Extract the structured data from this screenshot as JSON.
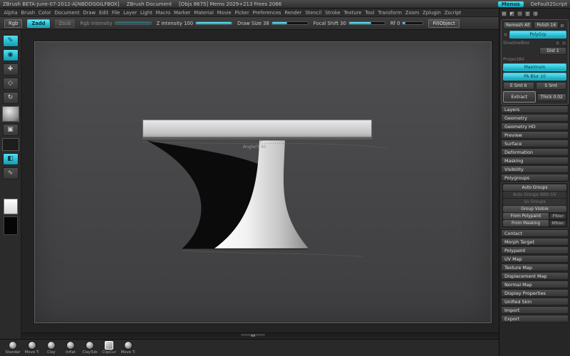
{
  "colors": {
    "accent": "#2fc9de",
    "panel_bg": "#262626",
    "canvas_bg": "#3f3f41"
  },
  "title_bar": {
    "app_title": "ZBrush BETA-June-07-2012-A[NBDDGGILFBOX]",
    "doc_title": "ZBrush Document",
    "stats": "[Objs 8675] Mems 2029+213 Frees 2066",
    "menus_label": "Menus",
    "script_label": "DeFault2Script"
  },
  "menu_bar": {
    "items": [
      "Alpha",
      "Brush",
      "Color",
      "Document",
      "Draw",
      "Edit",
      "File",
      "Layer",
      "Light",
      "Macro",
      "Marker",
      "Material",
      "Movie",
      "Picker",
      "Preferences",
      "Render",
      "Stencil",
      "Stroke",
      "Texture",
      "Tool",
      "Transform",
      "Zoom",
      "Zplugin",
      "Zscript"
    ]
  },
  "top_shelf": {
    "rgb": "Rgb",
    "zadd": "Zadd",
    "zsub": "Zsub",
    "rgb_intensity": "Rgb Intensity",
    "z_intensity": "Z Intensity 100",
    "draw_size": "Draw Size 38",
    "focal_shift": "Focal Shift 30",
    "rf": "Rf 0",
    "fill_object": "FillObject"
  },
  "left_shelf": {
    "icons": {
      "edit": "✎",
      "draw": "◉",
      "move": "✚",
      "scale": "◇",
      "rotate": "↻",
      "defo": "▣",
      "sample": "◧",
      "stroke": "∿"
    }
  },
  "canvas": {
    "annotation": "Angle(Y 90",
    "axis_mark": "+"
  },
  "right_panel": {
    "header_icons": [
      "▤",
      "◩",
      "◎",
      "▥",
      "◍"
    ],
    "subtool_box": {
      "remesh_all": "Remesh All",
      "polish": "Polish 16",
      "polish_curve_icon": "⊙",
      "polygrp": "PolyGrp",
      "shadowbox": "ShadowBox",
      "dist": "Dist 1",
      "projectall": "ProjectAll",
      "maximum": "Maximum",
      "pa_blur": "PA Blur 10",
      "e_smt": "E Smt 6",
      "s_smt": "S Smt",
      "extract": "Extract",
      "thick": "Thick 0.02"
    },
    "sections_top": [
      "Layers",
      "Geometry",
      "Geometry HD",
      "Preview",
      "Surface",
      "Deformation",
      "Masking",
      "Visibility"
    ],
    "polygroups": {
      "header": "Polygroups",
      "auto_groups": "Auto Groups",
      "auto_groups_uv": "Auto Groups With UV",
      "uv_groups": "Uv Groups",
      "group_visible": "Group Visible",
      "from_polypaint": "From Polypaint",
      "ptol": "PTolor",
      "from_masking": "From Masking",
      "mtol": "MTolor"
    },
    "sections_bottom": [
      "Contact",
      "Morph Target",
      "Polypaint",
      "UV Map",
      "Texture Map",
      "Displacement Map",
      "Normal Map",
      "Display Properties",
      "Unified Skin",
      "Import",
      "Export"
    ]
  },
  "bottom_bar": {
    "brushes": [
      "Standar",
      "Move T:",
      "Clay",
      "Inflat",
      "ClayTub",
      "ClipCur",
      "Move T:"
    ]
  }
}
